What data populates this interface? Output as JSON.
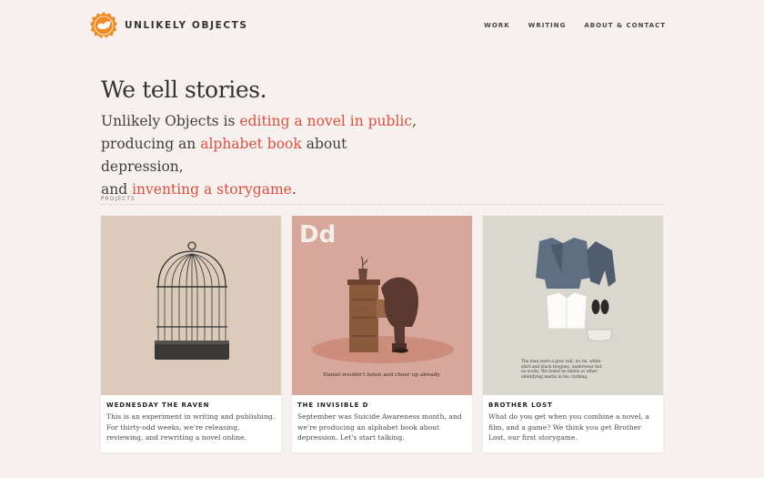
{
  "brand": {
    "name": "UNLIKELY OBJECTS",
    "logo": "bird-in-orange-seal-icon",
    "accent": "#f08a24"
  },
  "nav": {
    "items": [
      "WORK",
      "WRITING",
      "ABOUT & CONTACT"
    ]
  },
  "hero": {
    "heading": "We tell stories.",
    "line1_pre": "Unlikely Objects is ",
    "link1": "editing a novel in public",
    "line1_post": ",",
    "line2_pre": "producing an ",
    "link2": "alphabet book",
    "line2_post": " about depression,",
    "line3_pre": "and ",
    "link3": "inventing a storygame",
    "line3_post": ".",
    "link_color": "#d9503f"
  },
  "projects": {
    "label": "PROJECTS",
    "cards": [
      {
        "title": "WEDNESDAY THE RAVEN",
        "description": "This is an experiment in writing and publishing. For thirty-odd weeks, we're releasing, reviewing, and rewriting a novel online.",
        "art": "birdcage-icon"
      },
      {
        "title": "THE INVISIBLE D",
        "description": "September was Suicide Awareness month, and we're producing an alphabet book about depression. Let's start talking.",
        "art_letter": "Dd",
        "art_caption": "Daniel wouldn't listen and cheer up already.",
        "art": "figure-head-in-drawer-icon"
      },
      {
        "title": "BROTHER LOST",
        "description": "What do you get when you combine a novel, a film, and a game? We think you get Brother Lost, our first storygame.",
        "art_caption": "The man wore a grey suit, no tie, white shirt and black brogues, underwear but no socks. We found no labels or other identifying marks in his clothing.",
        "art": "laid-out-clothes-icon"
      }
    ]
  }
}
